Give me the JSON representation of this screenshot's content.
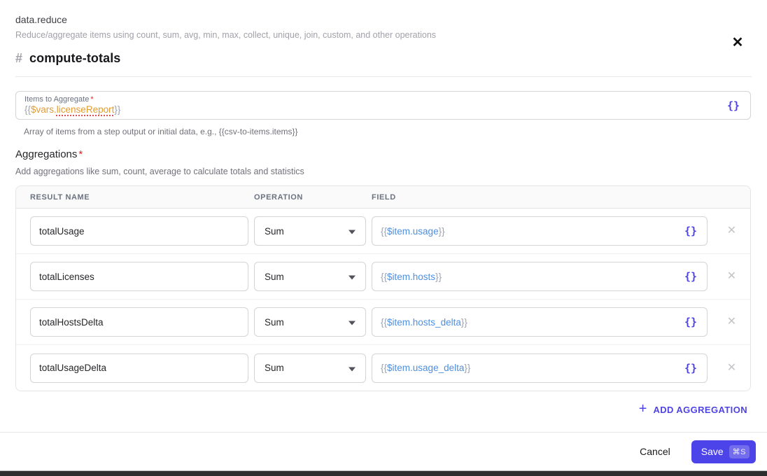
{
  "header": {
    "step_type": "data.reduce",
    "description": "Reduce/aggregate items using count, sum, avg, min, max, collect, unique, join, custom, and other operations",
    "step_name": "compute-totals",
    "hash_icon": "#",
    "close_icon": "✕"
  },
  "icons": {
    "braces": "{}",
    "remove": "✕"
  },
  "items_field": {
    "label": "Items to Aggregate",
    "required_mark": "*",
    "value_open": "{{",
    "value_scope": "$vars.",
    "value_name": "licenseReport",
    "value_close": "}}",
    "helper": "Array of items from a step output or initial data, e.g., {{csv-to-items.items}}"
  },
  "aggregations": {
    "title": "Aggregations",
    "required_mark": "*",
    "description": "Add aggregations like sum, count, average to calculate totals and statistics",
    "columns": {
      "result_name": "RESULT NAME",
      "operation": "OPERATION",
      "field": "FIELD"
    },
    "rows": [
      {
        "result_name": "totalUsage",
        "operation": "Sum",
        "field_open": "{{ ",
        "field_var": "$item.usage",
        "field_close": " }}"
      },
      {
        "result_name": "totalLicenses",
        "operation": "Sum",
        "field_open": "{{ ",
        "field_var": "$item.hosts",
        "field_close": " }}"
      },
      {
        "result_name": "totalHostsDelta",
        "operation": "Sum",
        "field_open": "{{ ",
        "field_var": "$item.hosts_delta",
        "field_close": " }}"
      },
      {
        "result_name": "totalUsageDelta",
        "operation": "Sum",
        "field_open": "{{ ",
        "field_var": "$item.usage_delta",
        "field_close": " }}"
      }
    ],
    "add_button": {
      "plus": "+",
      "label": "ADD AGGREGATION"
    }
  },
  "footer": {
    "cancel_label": "Cancel",
    "save_label": "Save",
    "save_shortcut": "⌘S"
  },
  "colors": {
    "accent_indigo": "#4c43e8",
    "token_orange": "#e39b2d",
    "token_blue": "#4e8fe0",
    "required_red": "#dc2626",
    "spellcheck_red": "#e05252"
  }
}
